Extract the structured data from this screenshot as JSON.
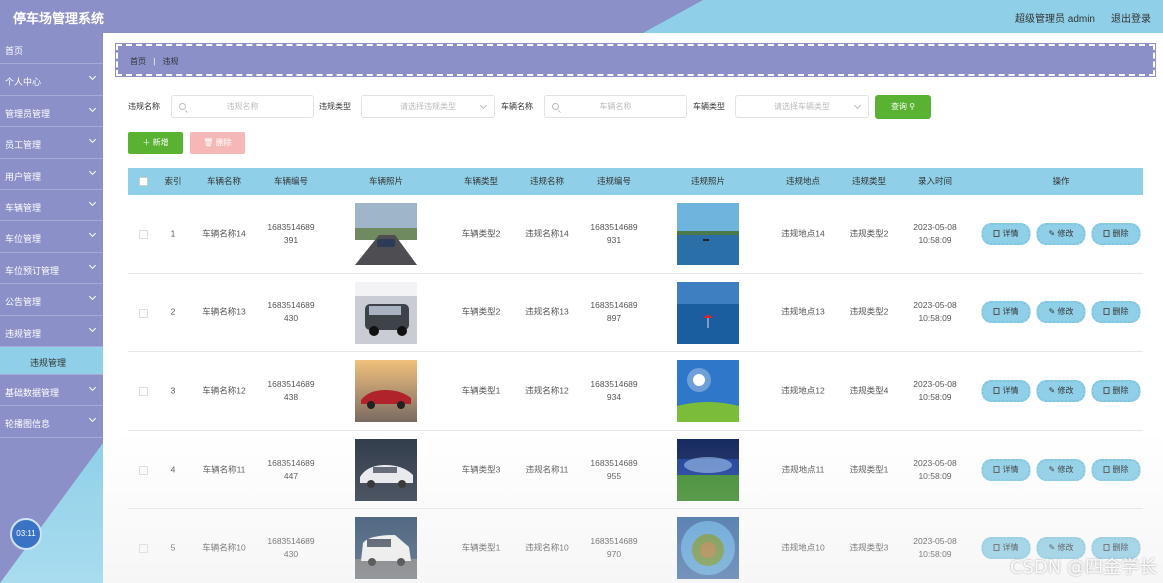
{
  "header": {
    "title": "停车场管理系统",
    "user": "超级管理员 admin",
    "logout": "退出登录"
  },
  "sidebar": {
    "items": [
      {
        "label": "首页",
        "chevron": false
      },
      {
        "label": "个人中心",
        "chevron": true
      },
      {
        "label": "管理员管理",
        "chevron": true
      },
      {
        "label": "员工管理",
        "chevron": true
      },
      {
        "label": "用户管理",
        "chevron": true
      },
      {
        "label": "车辆管理",
        "chevron": true
      },
      {
        "label": "车位管理",
        "chevron": true
      },
      {
        "label": "车位预订管理",
        "chevron": true
      },
      {
        "label": "公告管理",
        "chevron": true
      },
      {
        "label": "违规管理",
        "chevron": true
      },
      {
        "label": "违规管理",
        "sub": true
      },
      {
        "label": "基础数据管理",
        "chevron": true
      },
      {
        "label": "轮播图信息",
        "chevron": true
      }
    ],
    "clock": "03:11"
  },
  "breadcrumb": {
    "home": "首页",
    "sep": "|",
    "current": "违规"
  },
  "search": {
    "violation_name_label": "违规名称",
    "violation_name_placeholder": "违规名称",
    "violation_type_label": "违规类型",
    "violation_type_placeholder": "请选择违规类型",
    "vehicle_name_label": "车辆名称",
    "vehicle_name_placeholder": "车辆名称",
    "vehicle_type_label": "车辆类型",
    "vehicle_type_placeholder": "请选择车辆类型",
    "query_button": "查询"
  },
  "actions": {
    "add": "新增",
    "delete": "删除"
  },
  "table": {
    "columns": [
      "索引",
      "车辆名称",
      "车辆编号",
      "车辆照片",
      "车辆类型",
      "违规名称",
      "违规编号",
      "违规照片",
      "违规地点",
      "违规类型",
      "录入时间",
      "操作"
    ],
    "buttons": {
      "detail": "详情",
      "edit": "修改",
      "delete": "删除"
    },
    "rows": [
      {
        "index": "1",
        "vehicle_name": "车辆名称14",
        "vehicle_no_1": "1683514689",
        "vehicle_no_2": "391",
        "vehicle_photo": "road-car",
        "vehicle_type": "车辆类型2",
        "violation_name": "违规名称14",
        "violation_no_1": "1683514689",
        "violation_no_2": "931",
        "violation_photo": "lake",
        "location": "违规地点14",
        "violation_type": "违规类型2",
        "date": "2023-05-08",
        "time": "10:58:09"
      },
      {
        "index": "2",
        "vehicle_name": "车辆名称13",
        "vehicle_no_1": "1683514689",
        "vehicle_no_2": "430",
        "vehicle_photo": "gray-suv",
        "vehicle_type": "车辆类型2",
        "violation_name": "违规名称13",
        "violation_no_1": "1683514689",
        "violation_no_2": "897",
        "violation_photo": "sea-umbrella",
        "location": "违规地点13",
        "violation_type": "违规类型2",
        "date": "2023-05-08",
        "time": "10:58:09"
      },
      {
        "index": "3",
        "vehicle_name": "车辆名称12",
        "vehicle_no_1": "1683514689",
        "vehicle_no_2": "438",
        "vehicle_photo": "red-car",
        "vehicle_type": "车辆类型1",
        "violation_name": "违规名称12",
        "violation_no_1": "1683514689",
        "violation_no_2": "934",
        "violation_photo": "sky-field",
        "location": "违规地点12",
        "violation_type": "违规类型4",
        "date": "2023-05-08",
        "time": "10:58:09"
      },
      {
        "index": "4",
        "vehicle_name": "车辆名称11",
        "vehicle_no_1": "1683514689",
        "vehicle_no_2": "447",
        "vehicle_photo": "white-sedan",
        "vehicle_type": "车辆类型3",
        "violation_name": "违规名称11",
        "violation_no_1": "1683514689",
        "violation_no_2": "955",
        "violation_photo": "grass-sky",
        "location": "违规地点11",
        "violation_type": "违规类型1",
        "date": "2023-05-08",
        "time": "10:58:09"
      },
      {
        "index": "5",
        "vehicle_name": "车辆名称10",
        "vehicle_no_1": "1683514689",
        "vehicle_no_2": "430",
        "vehicle_photo": "white-van",
        "vehicle_type": "车辆类型1",
        "violation_name": "违规名称10",
        "violation_no_1": "1683514689",
        "violation_no_2": "970",
        "violation_photo": "tiny-planet",
        "location": "违规地点10",
        "violation_type": "违规类型3",
        "date": "2023-05-08",
        "time": "10:58:09"
      }
    ]
  },
  "watermark": "CSDN @四金学长",
  "colors": {
    "header": "#8b90c8",
    "accent": "#8fd0e8",
    "green": "#5ab232",
    "pink": "#f6b7b7"
  }
}
